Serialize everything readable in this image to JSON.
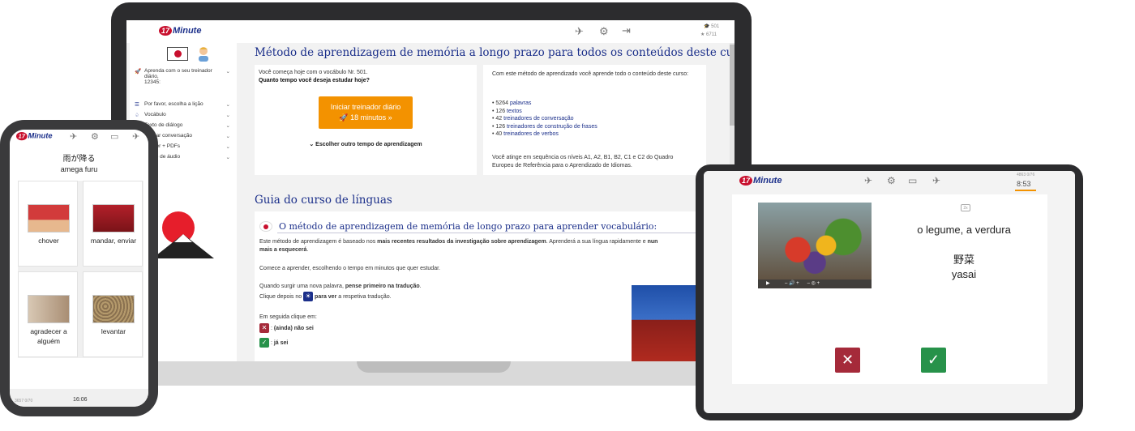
{
  "laptop": {
    "logo_num": "17",
    "logo_text": "Minute",
    "stats": {
      "words": "501",
      "stars": "6711"
    },
    "sidebar": {
      "trainer_label": "Aprenda com o seu treinador diário,",
      "trainer_value": "12345:",
      "items": [
        "Por favor, escolha a lição",
        "Vocábulo",
        "Texto de diálogo",
        "Treinar conversação",
        "Trainer + PDFs",
        "Curso de áudio"
      ]
    },
    "main_title": "Método de aprendizagem de memória a longo prazo para todos os conteúdos deste curso",
    "left_card": {
      "start_text": "Você começa hoje com o vocábulo Nr. 501.",
      "question": "Quanto tempo você deseja estudar hoje?",
      "button_line1": "Iniciar treinador diário",
      "button_line2": "18 minutos »",
      "choose_other": "Escolher outro tempo de aprendizagem"
    },
    "right_card": {
      "intro": "Com este método de aprendizado você aprende todo o conteúdo deste curso:",
      "list": [
        {
          "count": "5264",
          "label": "palavras"
        },
        {
          "count": "126",
          "label": "textos"
        },
        {
          "count": "42",
          "label": "treinadores de conversação"
        },
        {
          "count": "126",
          "label": "treinadores de construção de frases"
        },
        {
          "count": "40",
          "label": "treinadores de verbos"
        }
      ],
      "levels_line1": "Você atinge em sequência os níveis A1, A2, B1, B2, C1 e C2 do Quadro",
      "levels_line2": "Europeu de Referência para o Aprendizado de Idiomas."
    },
    "guide_title": "Guia do curso de línguas",
    "guide": {
      "subtitle": "O método de aprendizagem de memória de longo prazo para aprender vocabulário:",
      "p1_a": "Este método de aprendizagem é baseado nos ",
      "p1_b": "mais recentes resultados da investigação sobre aprendizagem",
      "p1_c": ". Aprenderá a sua língua rapidamente e ",
      "p1_d": "nun",
      "p1_e": "mais a esquecerá",
      "p1_f": ".",
      "p2": "Comece a aprender, escolhendo o tempo em minutos que quer estudar.",
      "p3_a": "Quando surgir uma nova palavra, ",
      "p3_b": "pense primeiro na tradução",
      "p3_c": ".",
      "p4_a": "Clique depois no ",
      "p4_b": "para ver",
      "p4_c": " a respetiva tradução.",
      "p5": "Em seguida clique em:",
      "no_label_a": ": ",
      "no_label_b": "(ainda) não sei",
      "yes_label_a": ": ",
      "yes_label_b": "já sei"
    }
  },
  "phone": {
    "logo_num": "17",
    "logo_text": "Minute",
    "word_jp": "雨が降る",
    "word_romaji": "amega furu",
    "tiles": [
      "chover",
      "mandar, enviar",
      "agradecer a alguém",
      "levantar"
    ],
    "time": "16:06",
    "stats": "3657  0/70"
  },
  "tablet": {
    "logo_num": "17",
    "logo_text": "Minute",
    "time": "8:53",
    "stats": "4863  0/76",
    "speaker_label": "2x",
    "translation": "o legume, a verdura",
    "word_jp": "野菜",
    "word_romaji": "yasai"
  },
  "colors": {
    "brand_blue": "#1b2f8a",
    "orange": "#f39200",
    "red": "#a52a3a",
    "green": "#27924a"
  }
}
